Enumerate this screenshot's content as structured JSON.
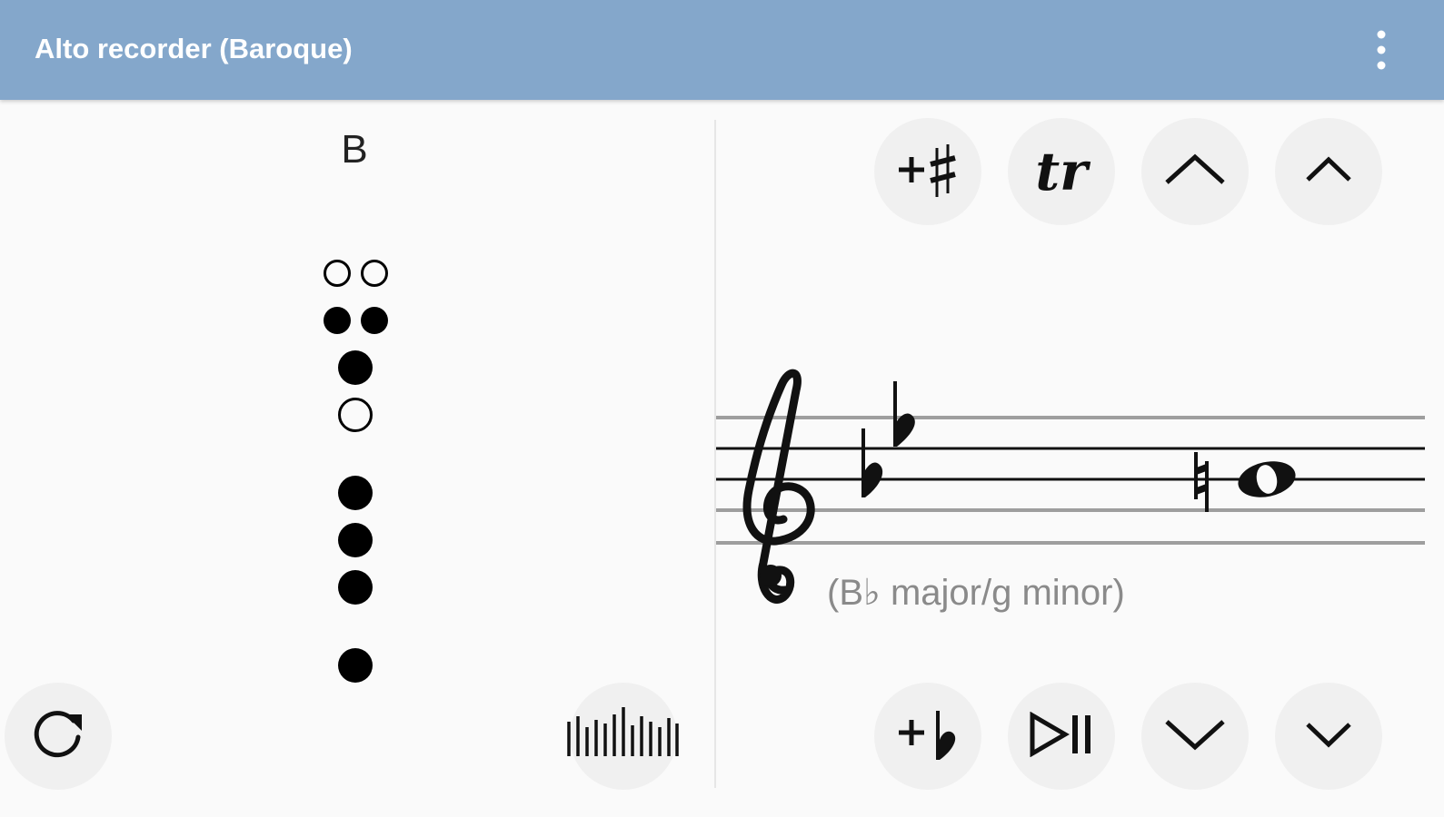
{
  "app": {
    "title": "Alto recorder (Baroque)",
    "menu_icon": "more-vert-icon",
    "accent_color": "#84a7cb"
  },
  "fingering": {
    "note": "B",
    "thumb_holes": [
      "open",
      "open"
    ],
    "double_holes": [
      "closed",
      "closed"
    ],
    "holes": [
      "closed",
      "open",
      "closed",
      "closed",
      "closed",
      "closed"
    ]
  },
  "buttons": {
    "reset": "reset-icon",
    "tuner": "tuner-icon",
    "add_sharp": "add-sharp-icon",
    "trill": "tr",
    "octave_up": "chevron-up-large-icon",
    "semitone_up": "chevron-up-small-icon",
    "add_flat": "add-flat-icon",
    "play_pause": "play-pause-icon",
    "octave_down": "chevron-down-large-icon",
    "semitone_down": "chevron-down-small-icon"
  },
  "staff": {
    "clef": "treble",
    "key_signature": "B♭ major/g minor",
    "key_label": "(B♭ major/g minor)",
    "note": "B",
    "accidental": "natural"
  }
}
